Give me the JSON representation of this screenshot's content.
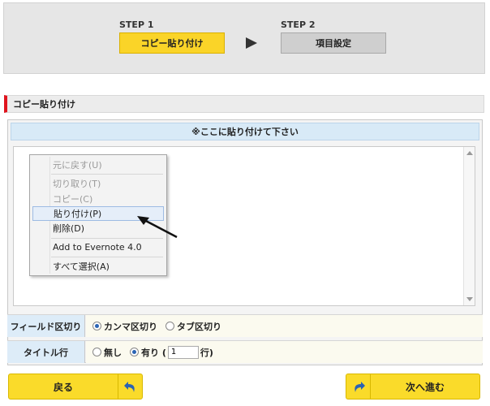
{
  "steps": {
    "step1": {
      "label": "STEP 1",
      "name": "コピー貼り付け",
      "active": true
    },
    "step2": {
      "label": "STEP 2",
      "name": "項目設定",
      "active": false
    }
  },
  "section": {
    "title": "コピー貼り付け"
  },
  "panel": {
    "title": "※ここに貼り付けて下さい"
  },
  "context_menu": {
    "items": [
      {
        "label": "元に戻す(U)",
        "enabled": false
      },
      {
        "label": "切り取り(T)",
        "enabled": false
      },
      {
        "label": "コピー(C)",
        "enabled": false
      },
      {
        "label": "貼り付け(P)",
        "enabled": true,
        "highlighted": true
      },
      {
        "label": "削除(D)",
        "enabled": true
      },
      {
        "label": "Add to Evernote 4.0",
        "enabled": true
      },
      {
        "label": "すべて選択(A)",
        "enabled": true
      }
    ]
  },
  "field_separator": {
    "label": "フィールド区切り",
    "options": [
      {
        "label": "カンマ区切り",
        "selected": true
      },
      {
        "label": "タブ区切り",
        "selected": false
      }
    ]
  },
  "title_row": {
    "label": "タイトル行",
    "options": [
      {
        "label": "無し",
        "selected": false
      },
      {
        "label": "有り (",
        "selected": true
      }
    ],
    "row_value": "1",
    "row_suffix": "行)"
  },
  "buttons": {
    "back": "戻る",
    "next": "次へ進む"
  },
  "colors": {
    "accent_yellow": "#fad428",
    "section_marker": "#e0141e",
    "header_blue": "#d8eaf7"
  }
}
